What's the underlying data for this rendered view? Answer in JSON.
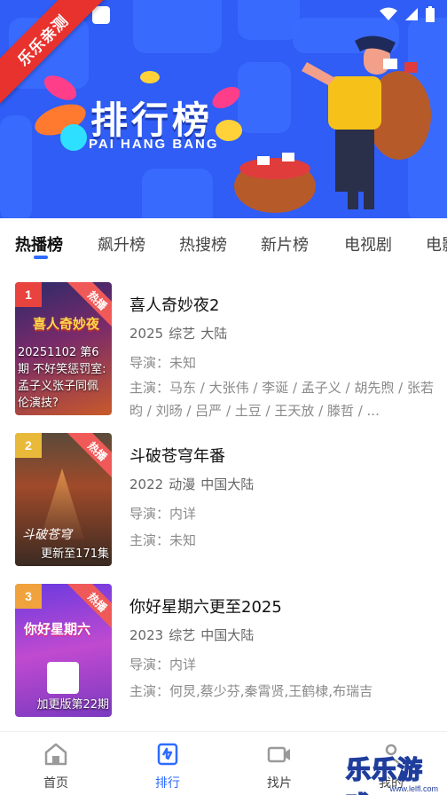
{
  "banner": {
    "ribbon_text": "乐乐亲测",
    "title": "排行榜",
    "subtitle": "PAI HANG BANG"
  },
  "tabs": [
    {
      "label": "热播榜",
      "active": true
    },
    {
      "label": "飙升榜",
      "active": false
    },
    {
      "label": "热搜榜",
      "active": false
    },
    {
      "label": "新片榜",
      "active": false
    },
    {
      "label": "电视剧",
      "active": false
    },
    {
      "label": "电影",
      "active": false
    }
  ],
  "items": [
    {
      "rank": "1",
      "rank_color": "#e8433f",
      "badge": "热播",
      "poster_caption": "20251102 第6期 不好笑惩罚室: 孟子义张子同佩伦演技?",
      "poster_overlay_title": "喜人奇妙夜",
      "title": "喜人奇妙夜2",
      "year": "2025",
      "genre": "综艺",
      "region": "大陆",
      "director": "导演：未知",
      "cast": "主演：马东 / 大张伟 / 李诞 / 孟子义 / 胡先煦 / 张若昀 / 刘旸 / 吕严 / 土豆 / 王天放 / 滕哲 / ..."
    },
    {
      "rank": "2",
      "rank_color": "#e9b93a",
      "badge": "热播",
      "poster_caption": "更新至171集",
      "poster_overlay_title": "斗破苍穹",
      "title": "斗破苍穹年番",
      "year": "2022",
      "genre": "动漫",
      "region": "中国大陆",
      "director": "导演：内详",
      "cast": "主演：未知"
    },
    {
      "rank": "3",
      "rank_color": "#f0a33c",
      "badge": "热播",
      "poster_caption": "加更版第22期",
      "poster_overlay_title": "你好星期六",
      "title": "你好星期六更至2025",
      "year": "2023",
      "genre": "综艺",
      "region": "中国大陆",
      "director": "导演：内详",
      "cast": "主演：何炅,蔡少芬,秦霄贤,王鹤棣,布瑞吉"
    }
  ],
  "bottom_nav": [
    {
      "label": "首页",
      "icon": "home-icon",
      "active": false
    },
    {
      "label": "排行",
      "icon": "ranking-icon",
      "active": true
    },
    {
      "label": "找片",
      "icon": "video-camera-icon",
      "active": false
    },
    {
      "label": "我的",
      "icon": "user-icon",
      "active": false
    }
  ],
  "watermark": {
    "text": "乐乐游戏",
    "url": "www.lelfl.com"
  },
  "colors": {
    "banner_bg": "#2f5df5",
    "accent": "#2f6bff",
    "hot_badge": "#ef5a59"
  }
}
